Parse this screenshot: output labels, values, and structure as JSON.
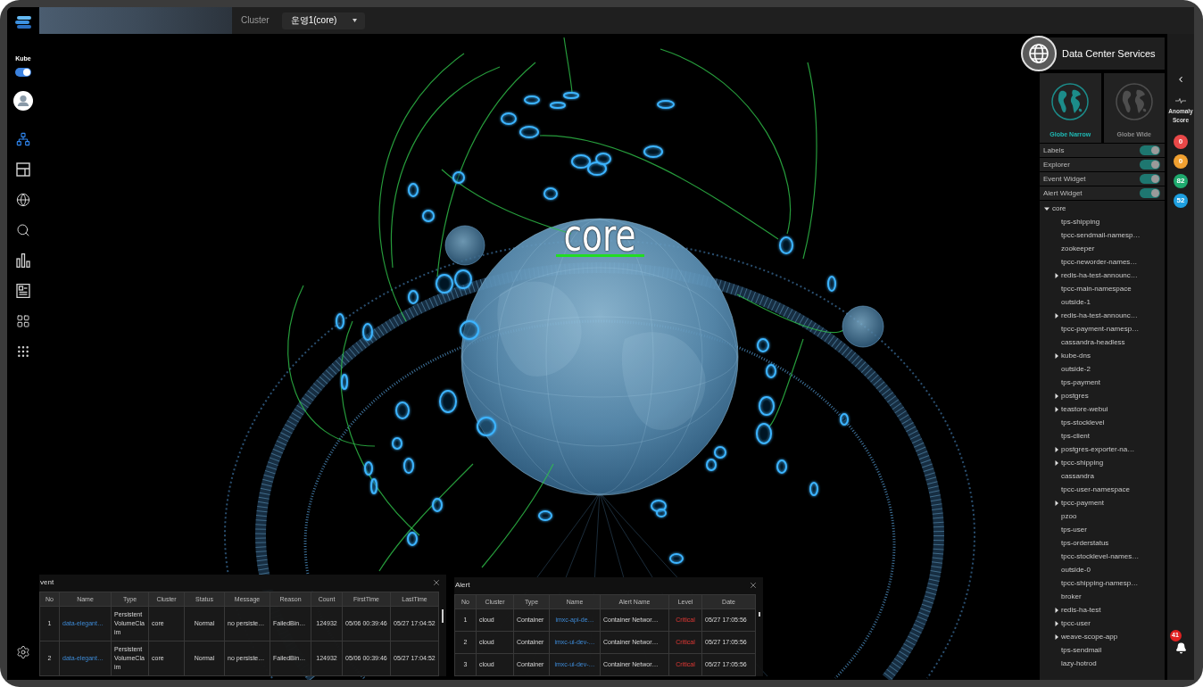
{
  "header": {
    "cluster_label": "Cluster",
    "cluster_select": {
      "value": "운영1(core)"
    }
  },
  "sidebar": {
    "kube_toggle": {
      "label": "Kube",
      "on": true
    },
    "nav": [
      {
        "selected": true
      },
      {
        "selected": false
      },
      {
        "selected": false
      },
      {
        "selected": false
      },
      {
        "selected": false
      },
      {
        "selected": false
      },
      {
        "selected": false
      },
      {
        "selected": false
      }
    ]
  },
  "scene": {
    "globe_label": "core"
  },
  "event_panel": {
    "title": "vent",
    "columns": [
      {
        "label": "No",
        "kind": "text"
      },
      {
        "label": "Name",
        "kind": "link"
      },
      {
        "label": "Type",
        "kind": "text"
      },
      {
        "label": "Cluster",
        "kind": "text"
      },
      {
        "label": "Status",
        "kind": "text"
      },
      {
        "label": "Message",
        "kind": "text"
      },
      {
        "label": "Reason",
        "kind": "text"
      },
      {
        "label": "Count",
        "kind": "text"
      },
      {
        "label": "FirstTime",
        "kind": "text"
      },
      {
        "label": "LastTime",
        "kind": "text"
      }
    ],
    "rows": [
      [
        "1",
        "data-elegant…",
        "PersistentVolumeClaim",
        "core",
        "Normal",
        "no persiste…",
        "FailedBin…",
        "124932",
        "05/06 00:39:46",
        "05/27 17:04:52"
      ],
      [
        "2",
        "data-elegant…",
        "PersistentVolumeClaim",
        "core",
        "Normal",
        "no persiste…",
        "FailedBin…",
        "124932",
        "05/06 00:39:46",
        "05/27 17:04:52"
      ]
    ]
  },
  "alert_panel": {
    "title": "Alert",
    "columns": [
      {
        "label": "No",
        "kind": "text"
      },
      {
        "label": "Cluster",
        "kind": "text"
      },
      {
        "label": "Type",
        "kind": "text"
      },
      {
        "label": "Name",
        "kind": "link"
      },
      {
        "label": "Alert Name",
        "kind": "text"
      },
      {
        "label": "Level",
        "kind": "severity"
      },
      {
        "label": "Date",
        "kind": "text"
      }
    ],
    "rows": [
      [
        "1",
        "cloud",
        "Container",
        "imxc-api-de…",
        "Container Networ…",
        "Critical",
        "05/27 17:05:56"
      ],
      [
        "2",
        "cloud",
        "Container",
        "imxc-ui-dev-…",
        "Container Networ…",
        "Critical",
        "05/27 17:05:56"
      ],
      [
        "3",
        "cloud",
        "Container",
        "imxc-ui-dev-…",
        "Container Networ…",
        "Critical",
        "05/27 17:05:56"
      ]
    ]
  },
  "right_panel": {
    "title": "Data Center Services",
    "views": [
      {
        "label": "Globe Narrow",
        "selected": true
      },
      {
        "label": "Globe Wide",
        "selected": false
      }
    ],
    "toggles": [
      {
        "label": "Labels",
        "on": true
      },
      {
        "label": "Explorer",
        "on": true
      },
      {
        "label": "Event Widget",
        "on": true
      },
      {
        "label": "Alert Widget",
        "on": true
      }
    ],
    "tree": {
      "label": "core",
      "expanded": true,
      "children": [
        {
          "label": "tps-shipping",
          "kind": "leaf"
        },
        {
          "label": "tpcc-sendmail-namesp…",
          "kind": "leaf"
        },
        {
          "label": "zookeeper",
          "kind": "leaf"
        },
        {
          "label": "tpcc-neworder-names…",
          "kind": "leaf"
        },
        {
          "label": "redis-ha-test-announc…",
          "kind": "group",
          "expanded": false
        },
        {
          "label": "tpcc-main-namespace",
          "kind": "leaf"
        },
        {
          "label": "outside-1",
          "kind": "leaf"
        },
        {
          "label": "redis-ha-test-announc…",
          "kind": "group",
          "expanded": false
        },
        {
          "label": "tpcc-payment-namesp…",
          "kind": "leaf"
        },
        {
          "label": "cassandra-headless",
          "kind": "leaf"
        },
        {
          "label": "kube-dns",
          "kind": "group",
          "expanded": false
        },
        {
          "label": "outside-2",
          "kind": "leaf"
        },
        {
          "label": "tps-payment",
          "kind": "leaf"
        },
        {
          "label": "postgres",
          "kind": "group",
          "expanded": false
        },
        {
          "label": "teastore-webui",
          "kind": "group",
          "expanded": false
        },
        {
          "label": "tps-stocklevel",
          "kind": "leaf"
        },
        {
          "label": "tps-client",
          "kind": "leaf"
        },
        {
          "label": "postgres-exporter-na…",
          "kind": "group",
          "expanded": false
        },
        {
          "label": "tpcc-shipping",
          "kind": "group",
          "expanded": false
        },
        {
          "label": "cassandra",
          "kind": "leaf"
        },
        {
          "label": "tpcc-user-namespace",
          "kind": "leaf"
        },
        {
          "label": "tpcc-payment",
          "kind": "group",
          "expanded": false
        },
        {
          "label": "pzoo",
          "kind": "leaf"
        },
        {
          "label": "tps-user",
          "kind": "leaf"
        },
        {
          "label": "tps-orderstatus",
          "kind": "leaf"
        },
        {
          "label": "tpcc-stocklevel-names…",
          "kind": "leaf"
        },
        {
          "label": "outside-0",
          "kind": "leaf"
        },
        {
          "label": "tpcc-shipping-namesp…",
          "kind": "leaf"
        },
        {
          "label": "broker",
          "kind": "leaf"
        },
        {
          "label": "redis-ha-test",
          "kind": "group",
          "expanded": false
        },
        {
          "label": "tpcc-user",
          "kind": "group",
          "expanded": false
        },
        {
          "label": "weave-scope-app",
          "kind": "group",
          "expanded": false
        },
        {
          "label": "tps-sendmail",
          "kind": "leaf"
        },
        {
          "label": "lazy-hotrod",
          "kind": "leaf"
        }
      ]
    }
  },
  "score_strip": {
    "title": "Anomaly Score",
    "scores": [
      {
        "value": "0",
        "color": "#e94848"
      },
      {
        "value": "0",
        "color": "#f0a030"
      },
      {
        "value": "82",
        "color": "#1faa6e"
      },
      {
        "value": "52",
        "color": "#1e9fe0"
      }
    ],
    "notification_count": "41"
  }
}
